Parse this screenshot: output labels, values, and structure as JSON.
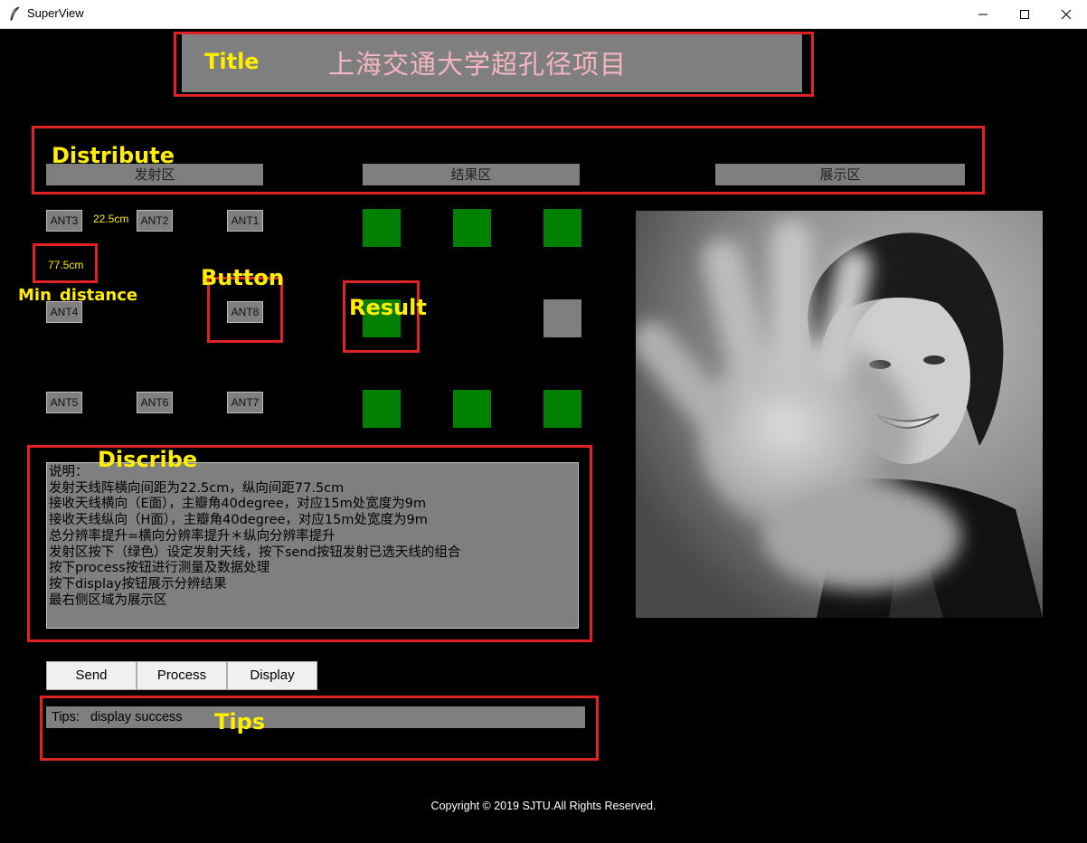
{
  "window": {
    "title": "SuperView",
    "icon": "feather-icon"
  },
  "banner": {
    "annotation": "Title",
    "text": "上海交通大学超孔径项目"
  },
  "annotations": {
    "distribute": "Distribute",
    "min_distance": "Min_distance",
    "button": "Button",
    "result": "Result",
    "discribe": "Discribe",
    "tips": "Tips"
  },
  "sections": {
    "transmit": "发射区",
    "result": "结果区",
    "display": "展示区"
  },
  "distances": {
    "horizontal": "22.5cm",
    "vertical": "77.5cm"
  },
  "antennas": {
    "ant3": "ANT3",
    "ant2": "ANT2",
    "ant1": "ANT1",
    "ant4": "ANT4",
    "ant8": "ANT8",
    "ant5": "ANT5",
    "ant6": "ANT6",
    "ant7": "ANT7"
  },
  "result_grid": {
    "colors": {
      "active": "#008000",
      "inactive": "#7f7f7f"
    },
    "rows": [
      [
        "active",
        "active",
        "active"
      ],
      [
        "active",
        "none",
        "inactive"
      ],
      [
        "active",
        "active",
        "active"
      ]
    ]
  },
  "description": [
    "说明：",
    "发射天线阵横向间距为22.5cm，纵向间距77.5cm",
    "接收天线横向（E面），主瓣角40degree，对应15m处宽度为9m",
    "接收天线纵向（H面），主瓣角40degree，对应15m处宽度为9m",
    "总分辨率提升=横向分辨率提升＊纵向分辨率提升",
    "发射区按下（绿色）设定发射天线，按下send按钮发射已选天线的组合",
    "按下process按钮进行测量及数据处理",
    "按下display按钮展示分辨结果",
    "最右侧区域为展示区"
  ],
  "actions": {
    "send": "Send",
    "process": "Process",
    "display": "Display"
  },
  "tips": {
    "text": "Tips:   display success"
  },
  "footer": {
    "copyright": "Copyright © 2019 SJTU.All Rights Reserved."
  },
  "colors": {
    "annotation_box": "#e02227",
    "annotation_text": "#ffee00",
    "panel_gray": "#7f7f7f",
    "banner_text": "#f4b6c2"
  }
}
